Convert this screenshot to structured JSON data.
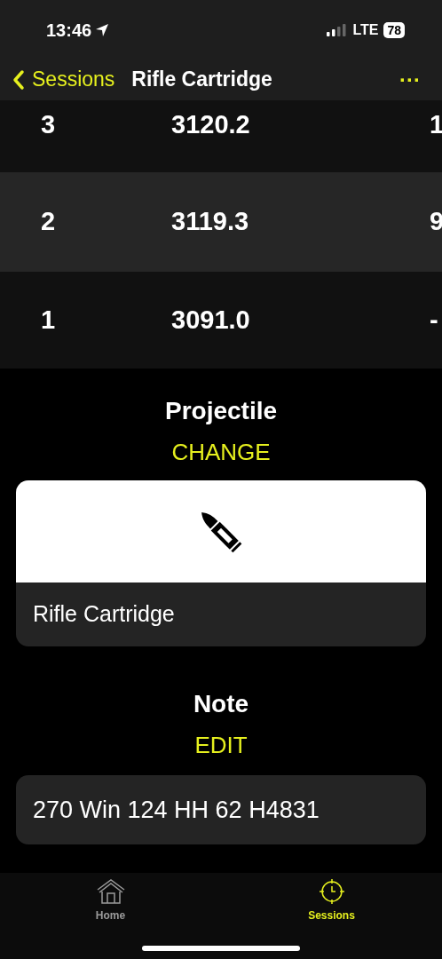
{
  "status_bar": {
    "time": "13:46",
    "network": "LTE",
    "battery": "78"
  },
  "nav_bar": {
    "back": "Sessions",
    "title": "Rifle Cartridge",
    "more": "···"
  },
  "table": {
    "rows": [
      {
        "column_1": "3",
        "column_2": "3120.2",
        "column_3": "1"
      },
      {
        "column_1": "2",
        "column_2": "3119.3",
        "column_3": "9"
      },
      {
        "column_1": "1",
        "column_2": "3091.0",
        "column_3": "-"
      }
    ]
  },
  "projectile": {
    "heading": "Projectile",
    "action": "CHANGE",
    "name": "Rifle Cartridge"
  },
  "note": {
    "heading": "Note",
    "action": "EDIT",
    "text": "270 Win 124 HH 62 H4831"
  },
  "tab_bar": [
    {
      "label": "Home",
      "kind": "home",
      "selected": false
    },
    {
      "label": "Sessions",
      "kind": "sessions",
      "selected": true
    }
  ]
}
